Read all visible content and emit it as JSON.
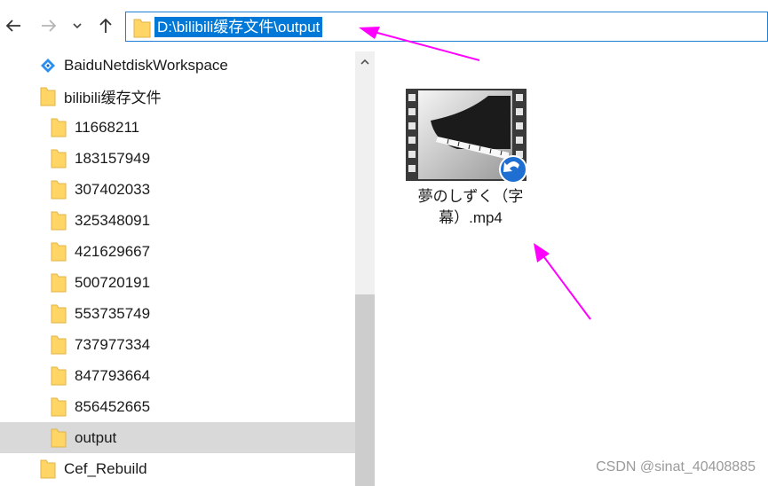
{
  "toolbar": {
    "back_icon": "arrow-left-icon",
    "forward_icon": "arrow-right-icon",
    "recent_icon": "chevron-down-icon",
    "up_icon": "arrow-up-icon",
    "address": "D:\\bilibili缓存文件\\output"
  },
  "nav_pane": {
    "items": [
      {
        "label": "BaiduNetdiskWorkspace",
        "icon": "baidu-netdisk-icon",
        "level": 0,
        "selected": false
      },
      {
        "label": "bilibili缓存文件",
        "icon": "folder-icon",
        "level": 0,
        "selected": false
      },
      {
        "label": "11668211",
        "icon": "folder-icon",
        "level": 1,
        "selected": false
      },
      {
        "label": "183157949",
        "icon": "folder-icon",
        "level": 1,
        "selected": false
      },
      {
        "label": "307402033",
        "icon": "folder-icon",
        "level": 1,
        "selected": false
      },
      {
        "label": "325348091",
        "icon": "folder-icon",
        "level": 1,
        "selected": false
      },
      {
        "label": "421629667",
        "icon": "folder-icon",
        "level": 1,
        "selected": false
      },
      {
        "label": "500720191",
        "icon": "folder-icon",
        "level": 1,
        "selected": false
      },
      {
        "label": "553735749",
        "icon": "folder-icon",
        "level": 1,
        "selected": false
      },
      {
        "label": "737977334",
        "icon": "folder-icon",
        "level": 1,
        "selected": false
      },
      {
        "label": "847793664",
        "icon": "folder-icon",
        "level": 1,
        "selected": false
      },
      {
        "label": "856452665",
        "icon": "folder-icon",
        "level": 1,
        "selected": false
      },
      {
        "label": "output",
        "icon": "folder-icon",
        "level": 1,
        "selected": true
      },
      {
        "label": "Cef_Rebuild",
        "icon": "folder-icon",
        "level": 0,
        "selected": false
      }
    ]
  },
  "content": {
    "files": [
      {
        "name_line1": "夢のしずく（字",
        "name_line2": "幕）.mp4",
        "icon": "video-file-icon",
        "overlay_icon": "media-player-badge-icon"
      }
    ]
  },
  "annotations": {
    "arrow_color": "#ff00ff"
  },
  "watermark": "CSDN @sinat_40408885",
  "colors": {
    "selection": "#0078d7",
    "selected_row": "#d9d9d9",
    "folder": "#ffd566",
    "scrollbar_thumb": "#cdcdcd"
  }
}
